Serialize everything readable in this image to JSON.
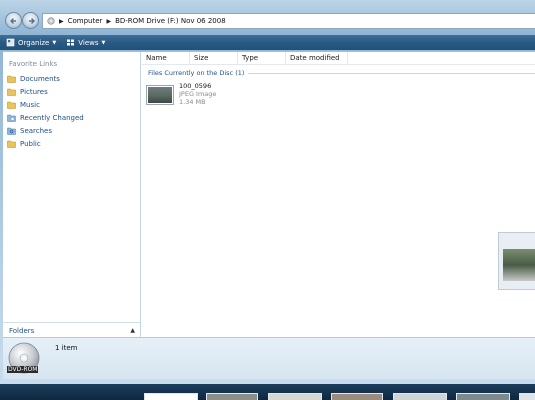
{
  "address": {
    "crumbs": [
      "Computer",
      "BD-ROM Drive (F:) Nov 06 2008"
    ]
  },
  "toolbar": {
    "organize_label": "Organize",
    "views_label": "Views"
  },
  "nav_pane": {
    "title": "Favorite Links",
    "items": [
      {
        "label": "Documents",
        "icon": "folder-icon"
      },
      {
        "label": "Pictures",
        "icon": "folder-icon"
      },
      {
        "label": "Music",
        "icon": "folder-icon"
      },
      {
        "label": "Recently Changed",
        "icon": "recent-icon"
      },
      {
        "label": "Searches",
        "icon": "search-folder-icon"
      },
      {
        "label": "Public",
        "icon": "folder-icon"
      }
    ],
    "folders_label": "Folders"
  },
  "file_pane": {
    "columns": [
      "Name",
      "Size",
      "Type",
      "Date modified"
    ],
    "group_header": "Files Currently on the Disc (1)",
    "files": [
      {
        "name": "100_0596",
        "type": "JPEG Image",
        "size": "1.34 MB"
      }
    ]
  },
  "details": {
    "drive_label": "DVD-ROM",
    "item_count": "1 item"
  },
  "colors": {
    "toolbar": "#2a5982",
    "link": "#1c4f91",
    "frame": "#9ec0db"
  }
}
